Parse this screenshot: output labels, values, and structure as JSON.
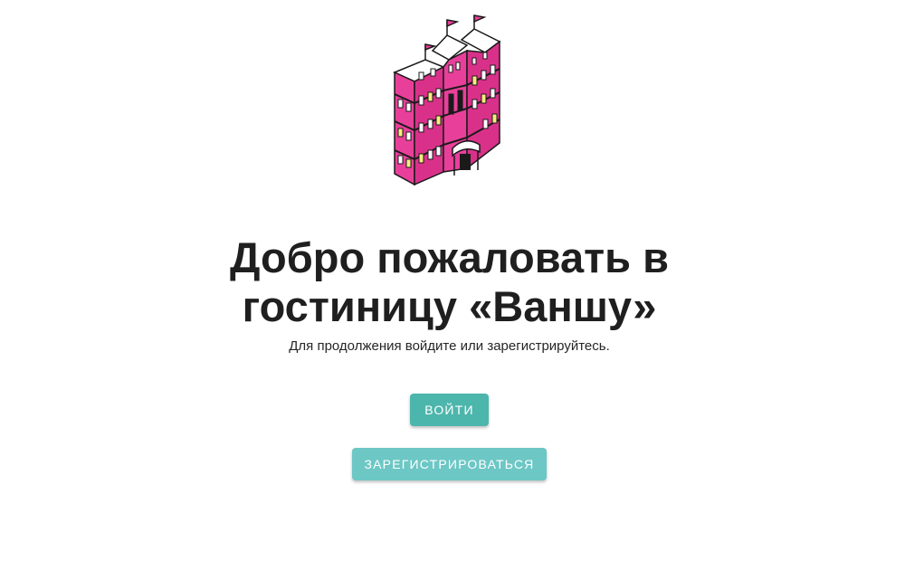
{
  "colors": {
    "accent": "#4db6ac",
    "accent_light": "#6cc7c5",
    "illustration_pink": "#e8409a",
    "illustration_window": "#f7ef7c"
  },
  "illustration": {
    "icon": "pink-hotel-building-illustration"
  },
  "welcome": {
    "title_line1": "Добро пожаловать в",
    "title_line2": "гостиницу «Ваншу»",
    "subtitle": "Для продолжения войдите или зарегистрируйтесь."
  },
  "actions": {
    "login_label": "ВОЙТИ",
    "register_label": "ЗАРЕГИСТРИРОВАТЬСЯ"
  }
}
